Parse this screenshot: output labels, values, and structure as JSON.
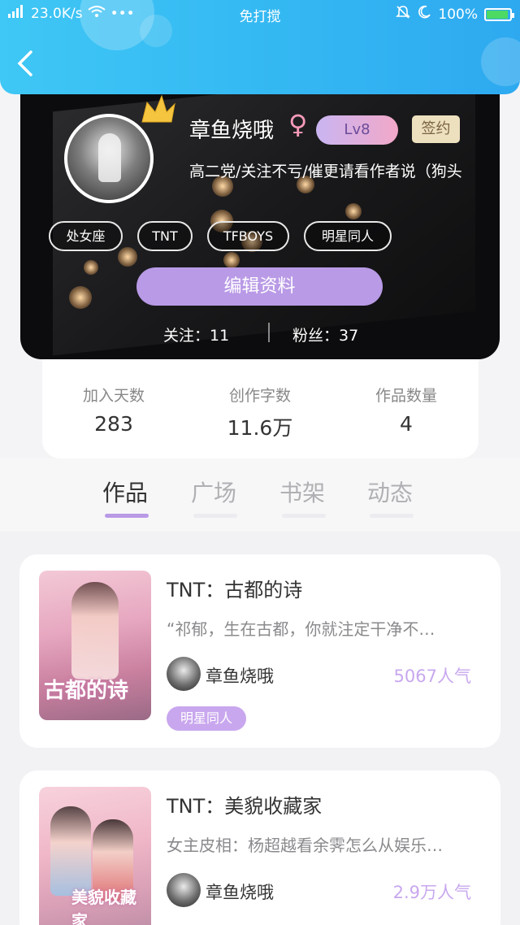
{
  "status_bar": {
    "speed": "23.0K/s",
    "dots": "•••",
    "mode": "免打搅",
    "battery": "100%"
  },
  "profile": {
    "name": "章鱼烧哦",
    "gender_symbol": "♀",
    "level": "Lv8",
    "signed": "签约",
    "bio": "高二党/关注不亏/催更请看作者说（狗头",
    "tags": [
      "处女座",
      "TNT",
      "TFBOYS",
      "明星同人"
    ],
    "edit_label": "编辑资料",
    "following_label": "关注：",
    "following": "11",
    "fans_label": "粉丝：",
    "fans": "37"
  },
  "stats": [
    {
      "label": "加入天数",
      "value": "283"
    },
    {
      "label": "创作字数",
      "value": "11.6万"
    },
    {
      "label": "作品数量",
      "value": "4"
    }
  ],
  "tabs": [
    {
      "label": "作品",
      "active": true
    },
    {
      "label": "广场",
      "active": false
    },
    {
      "label": "书架",
      "active": false
    },
    {
      "label": "动态",
      "active": false
    }
  ],
  "books": [
    {
      "title": "TNT：古都的诗",
      "description": "“祁郁，生在古都，你就注定干净不…",
      "author": "章鱼烧哦",
      "popularity": "5067人气",
      "category": "明星同人",
      "cover_text": "古都的诗"
    },
    {
      "title": "TNT：美貌收藏家",
      "description": "女主皮相：杨超越看余霁怎么从娱乐…",
      "author": "章鱼烧哦",
      "popularity": "2.9万人气",
      "cover_text": "美貌收藏家"
    }
  ],
  "colors": {
    "header": "#33b6f2",
    "accent_purple": "#b99ae6",
    "popularity": "#c8a8ee"
  }
}
